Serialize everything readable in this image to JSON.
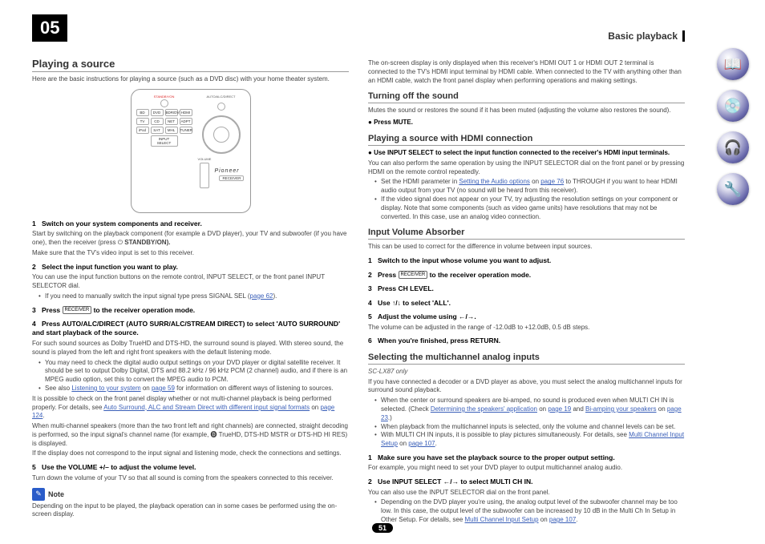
{
  "header": {
    "chapter": "05",
    "breadcrumb": "Basic playback"
  },
  "left": {
    "h1": "Playing a source",
    "intro": "Here are the basic instructions for playing a source (such as a DVD disc) with your home theater system.",
    "remote": {
      "standby_label": "STANDBY/ON",
      "auto_label": "AUTO/ALC/DIRECT",
      "rows": [
        [
          "BD",
          "DVD",
          "BDR/DVR",
          "HDMI"
        ],
        [
          "TV",
          "CD",
          "NET",
          "ADPT"
        ],
        [
          "iPod",
          "SAT",
          "MHL",
          "TUNER"
        ]
      ],
      "input_select": "INPUT SELECT",
      "volume": "VOLUME",
      "brand": "Pioneer",
      "receiver": "RECEIVER"
    },
    "s1": "Switch on your system components and receiver.",
    "s1_body1": "Start by switching on the playback component (for example a DVD player), your TV and subwoofer (if you have one), then the receiver (press ",
    "s1_body1b": " STANDBY/ON).",
    "s1_body2": "Make sure that the TV's video input is set to this receiver.",
    "s2": "Select the input function you want to play.",
    "s2_body": "You can use the input function buttons on the remote control, INPUT SELECT, or the front panel INPUT SELECTOR dial.",
    "s2_bul1a": "If you need to manually switch the input signal type press SIGNAL SEL (",
    "s2_bul1_link": "page 62",
    "s2_bul1b": ").",
    "s3a": "Press ",
    "s3b": " to the receiver operation mode.",
    "s4": "Press AUTO/ALC/DIRECT (AUTO SURR/ALC/STREAM DIRECT) to select 'AUTO SURROUND' and start playback of the source.",
    "s4_body": "For such sound sources as Dolby TrueHD and DTS-HD, the surround sound is played. With stereo sound, the sound is played from the left and right front speakers with the default listening mode.",
    "s4_bul1": "You may need to check the digital audio output settings on your DVD player or digital satellite receiver. It should be set to output Dolby Digital, DTS and 88.2 kHz / 96 kHz PCM (2 channel) audio, and if there is an MPEG audio option, set this to convert the MPEG audio to PCM.",
    "s4_bul2a": "See also ",
    "s4_bul2_link": "Listening to your system",
    "s4_bul2b": " on ",
    "s4_bul2_link2": "page 59",
    "s4_bul2c": " for information on different ways of listening to sources.",
    "s4_p2a": "It is possible to check on the front panel display whether or not multi-channel playback is being performed properly. For details, see ",
    "s4_p2_link": "Auto Surround, ALC and Stream Direct with different input signal formats",
    "s4_p2b": " on ",
    "s4_p2_link2": "page 124",
    "s4_p2c": ".",
    "s4_p3": "When multi-channel speakers (more than the two front left and right channels) are connected, straight decoding is performed, so the input signal's channel name (for example, 🅓 TrueHD, DTS-HD MSTR or DTS-HD HI RES) is displayed.",
    "s4_p4": "If the display does not correspond to the input signal and listening mode, check the connections and settings.",
    "s5": "Use the VOLUME +/– to adjust the volume level.",
    "s5_body": "Turn down the volume of your TV so that all sound is coming from the speakers connected to this receiver.",
    "note_label": "Note",
    "note_body": "Depending on the input to be played, the playback operation can in some cases be performed using the on-screen display."
  },
  "right": {
    "top": "The on-screen display is only displayed when this receiver's HDMI OUT 1 or HDMI OUT 2 terminal is connected to the TV's HDMI input terminal by HDMI cable. When connected to the TV with anything other than an HDMI cable, watch the front panel display when performing operations and making settings.",
    "h2a": "Turning off the sound",
    "h2a_body": "Mutes the sound or restores the sound if it has been muted (adjusting the volume also restores the sound).",
    "h2a_step": "Press MUTE.",
    "h2b": "Playing a source with HDMI connection",
    "h2b_lead": "Use INPUT SELECT to select the input function connected to the receiver's HDMI input terminals.",
    "h2b_body": "You can also perform the same operation by using the INPUT SELECTOR dial on the front panel or by pressing HDMI on the remote control repeatedly.",
    "h2b_bul1a": "Set the HDMI parameter in ",
    "h2b_bul1_link": "Setting the Audio options",
    "h2b_bul1b": " on ",
    "h2b_bul1_link2": "page 76",
    "h2b_bul1c": " to THROUGH if you want to hear HDMI audio output from your TV (no sound will be heard from this receiver).",
    "h2b_bul2": "If the video signal does not appear on your TV, try adjusting the resolution settings on your component or display. Note that some components (such as video game units) have resolutions that may not be converted. In this case, use an analog video connection.",
    "h2c": "Input Volume Absorber",
    "h2c_body": "This can be used to correct for the difference in volume between input sources.",
    "h2c_s1": "Switch to the input whose volume you want to adjust.",
    "h2c_s2a": "Press ",
    "h2c_s2b": " to the receiver operation mode.",
    "h2c_s3": "Press CH LEVEL.",
    "h2c_s4": "Use ↑/↓ to select 'ALL'.",
    "h2c_s5": "Adjust the volume using ←/→.",
    "h2c_range": "The volume can be adjusted in the range of -12.0dB to +12.0dB, 0.5 dB steps.",
    "h2c_s6": "When you're finished, press RETURN.",
    "h2d": "Selecting the multichannel analog inputs",
    "h2d_model": "SC-LX87 only",
    "h2d_body": "If you have connected a decoder or a DVD player as above, you must select the analog multichannel inputs for surround sound playback.",
    "h2d_bul1a": "When the center or surround speakers are bi-amped, no sound is produced even when MULTI CH IN is selected. (Check ",
    "h2d_bul1_link": "Determining the speakers' application",
    "h2d_bul1b": " on ",
    "h2d_bul1_link2": "page 19",
    "h2d_bul1c": " and ",
    "h2d_bul1_link3": "Bi-amping your speakers",
    "h2d_bul1d": " on ",
    "h2d_bul1_link4": "page 23",
    "h2d_bul1e": ".)",
    "h2d_bul2": "When playback from the multichannel inputs is selected, only the volume and channel levels can be set.",
    "h2d_bul3a": "With MULTI CH IN inputs, it is possible to play pictures simultaneously. For details, see ",
    "h2d_bul3_link": "Multi Channel Input Setup",
    "h2d_bul3b": " on ",
    "h2d_bul3_link2": "page 107",
    "h2d_bul3c": ".",
    "h2d_s1": "Make sure you have set the playback source to the proper output setting.",
    "h2d_s1_body": "For example, you might need to set your DVD player to output multichannel analog audio.",
    "h2d_s2": "Use INPUT SELECT ←/→ to select MULTI CH IN.",
    "h2d_s2_body": "You can also use the INPUT SELECTOR dial on the front panel.",
    "h2d_s2_bul1a": "Depending on the DVD player you're using, the analog output level of the subwoofer channel may be too low. In this case, the output level of the subwoofer can be increased by 10 dB in the Multi Ch In Setup in Other Setup. For details, see ",
    "h2d_s2_bul1_link": "Multi Channel Input Setup",
    "h2d_s2_bul1b": " on ",
    "h2d_s2_bul1_link2": "page 107",
    "h2d_s2_bul1c": "."
  },
  "footer": {
    "page": "51"
  },
  "sidebar": {
    "icons": [
      "📖",
      "💿",
      "🎧",
      "🔧"
    ]
  }
}
